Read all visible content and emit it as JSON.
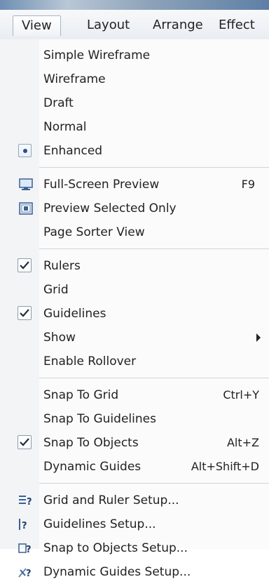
{
  "menubar": {
    "view": "View",
    "layout": "Layout",
    "arrange": "Arrange",
    "effects": "Effect"
  },
  "menu": {
    "simple_wireframe": "Simple Wireframe",
    "wireframe": "Wireframe",
    "draft": "Draft",
    "normal": "Normal",
    "enhanced": "Enhanced",
    "full_screen_preview": "Full-Screen Preview",
    "full_screen_shortcut": "F9",
    "preview_selected_only": "Preview Selected Only",
    "page_sorter_view": "Page Sorter View",
    "rulers": "Rulers",
    "grid": "Grid",
    "guidelines": "Guidelines",
    "show": "Show",
    "enable_rollover": "Enable Rollover",
    "snap_to_grid": "Snap To Grid",
    "snap_to_grid_shortcut": "Ctrl+Y",
    "snap_to_guidelines": "Snap To Guidelines",
    "snap_to_objects": "Snap To Objects",
    "snap_to_objects_shortcut": "Alt+Z",
    "dynamic_guides": "Dynamic Guides",
    "dynamic_guides_shortcut": "Alt+Shift+D",
    "grid_ruler_setup": "Grid and Ruler Setup...",
    "guidelines_setup": "Guidelines Setup...",
    "snap_objects_setup": "Snap to Objects Setup...",
    "dynamic_guides_setup": "Dynamic Guides Setup..."
  },
  "states": {
    "enhanced_selected": true,
    "rulers_checked": true,
    "guidelines_checked": true,
    "snap_to_objects_checked": true
  },
  "icons": {
    "full_screen_preview": "monitor-icon",
    "preview_selected_only": "preview-icon",
    "grid_ruler_setup": "grid-setup-icon",
    "guidelines_setup": "guidelines-setup-icon",
    "snap_objects_setup": "snap-setup-icon",
    "dynamic_guides_setup": "dynamic-guides-setup-icon"
  }
}
